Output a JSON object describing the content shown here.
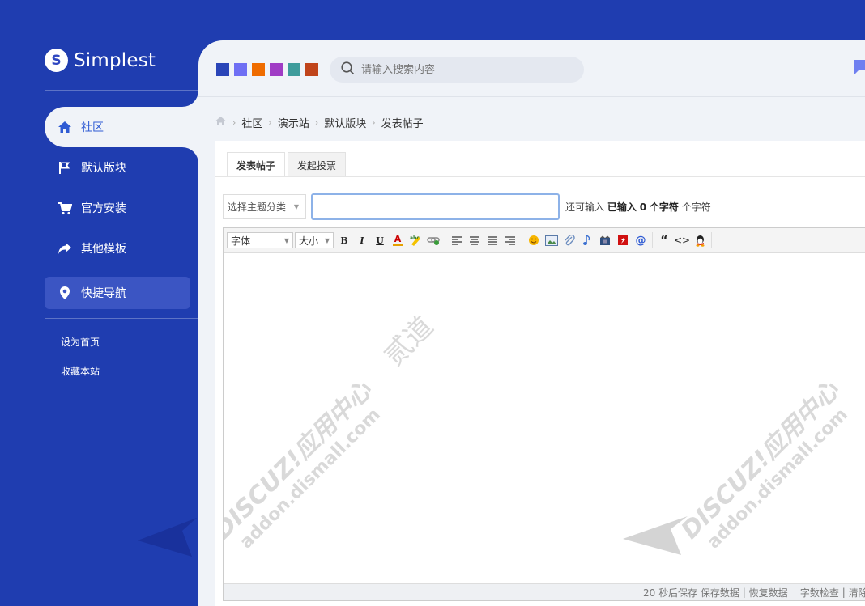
{
  "brand": {
    "logo_letter": "S",
    "name": "Simplest"
  },
  "sidebar": {
    "items": [
      {
        "label": "社区",
        "icon": "home-icon"
      },
      {
        "label": "默认版块",
        "icon": "flag-icon"
      },
      {
        "label": "官方安装",
        "icon": "cart-icon"
      },
      {
        "label": "其他模板",
        "icon": "share-arrow-icon"
      },
      {
        "label": "快捷导航",
        "icon": "location-pin-icon"
      }
    ],
    "links": [
      "设为首页",
      "收藏本站"
    ]
  },
  "theme_swatches": [
    "#2a45b8",
    "#6f6ff4",
    "#ef6c00",
    "#a03cc5",
    "#3f9c9c",
    "#c0441b"
  ],
  "search": {
    "placeholder": "请输入搜索内容"
  },
  "breadcrumb": [
    "社区",
    "演示站",
    "默认版块",
    "发表帖子"
  ],
  "tabs": [
    "发表帖子",
    "发起投票"
  ],
  "form": {
    "type_select": "选择主题分类",
    "title_value": "",
    "hint_prefix": "还可输入",
    "hint_mid": "已输入",
    "hint_count": "0",
    "hint_unit_bold": "个字符",
    "hint_unit": "个字符"
  },
  "toolbar": {
    "font_label": "字体",
    "size_label": "大小",
    "bold": "B",
    "italic": "I",
    "underline": "U",
    "color": "A",
    "quote": "“",
    "code": "<>"
  },
  "status_bar": {
    "autosave": "20 秒后保存",
    "save": "保存数据",
    "restore": "恢复数据",
    "wordcheck": "字数检查",
    "clear": "清除"
  },
  "watermark": {
    "line1": "DISCUZ!应用中心",
    "brand": "贰道",
    "line2": "addon.dismall.com"
  },
  "colors": {
    "sidebar_bg": "#1f3db0",
    "main_bg": "#f0f3f8",
    "active_text": "#2f5bd3"
  }
}
